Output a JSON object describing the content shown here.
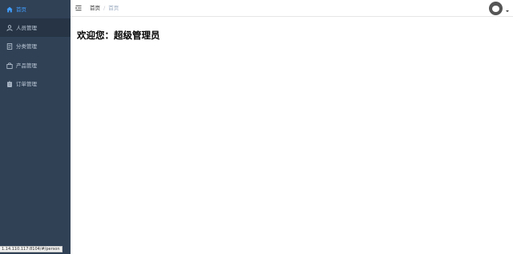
{
  "sidebar": {
    "items": [
      {
        "label": "首页",
        "icon": "home-icon"
      },
      {
        "label": "人员管理",
        "icon": "user-icon"
      },
      {
        "label": "分类管理",
        "icon": "document-icon"
      },
      {
        "label": "产品管理",
        "icon": "bag-icon"
      },
      {
        "label": "订单管理",
        "icon": "clipboard-icon"
      }
    ],
    "colors": {
      "background": "#304156",
      "active_background": "#263445",
      "text": "#bfcbd9",
      "current": "#409eff"
    }
  },
  "navbar": {
    "breadcrumb": {
      "link": "首页",
      "separator": "/",
      "current": "首页"
    },
    "avatar_icon": "avatar-icon",
    "menu_icon": "hamburger-icon"
  },
  "main": {
    "welcome": "欢迎您：超级管理员"
  },
  "statusbar": {
    "url": "1.14.110.117:8104/#/person"
  }
}
